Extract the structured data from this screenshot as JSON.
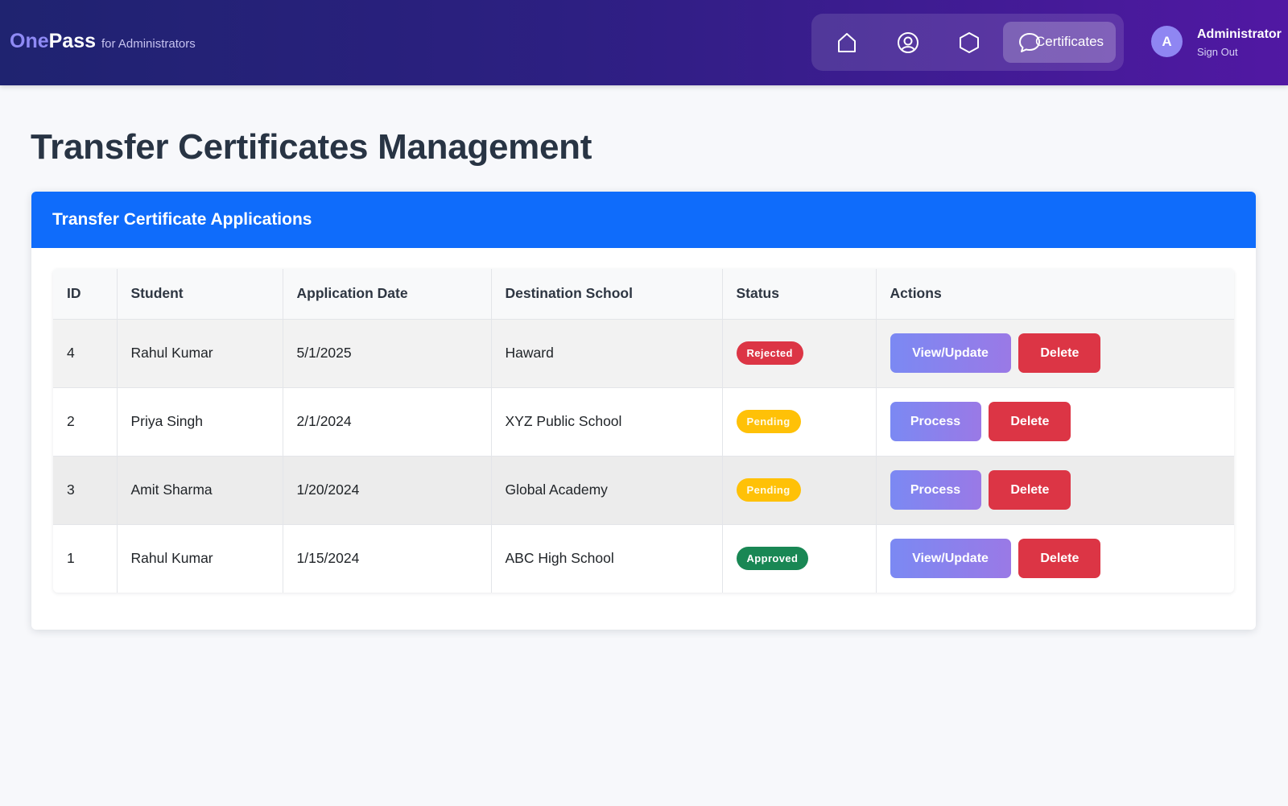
{
  "brand": {
    "name_part1": "One",
    "name_part2": "Pass",
    "subtitle": "for Administrators"
  },
  "nav": {
    "items": [
      {
        "icon": "home-icon"
      },
      {
        "icon": "user-circle-icon"
      },
      {
        "icon": "hexagon-icon"
      },
      {
        "icon": "chat-bubble-icon",
        "label": "Certificates",
        "active": true
      }
    ]
  },
  "user": {
    "avatar_letter": "A",
    "name": "Administrator",
    "signout": "Sign Out"
  },
  "page": {
    "title": "Transfer Certificates Management"
  },
  "card": {
    "title": "Transfer Certificate Applications"
  },
  "table": {
    "headers": [
      "ID",
      "Student",
      "Application Date",
      "Destination School",
      "Status",
      "Actions"
    ],
    "rows": [
      {
        "id": "4",
        "student": "Rahul Kumar",
        "date": "5/1/2025",
        "destination": "Haward",
        "status": "Rejected",
        "primary_action": "View/Update",
        "delete_action": "Delete"
      },
      {
        "id": "2",
        "student": "Priya Singh",
        "date": "2/1/2024",
        "destination": "XYZ Public School",
        "status": "Pending",
        "primary_action": "Process",
        "delete_action": "Delete"
      },
      {
        "id": "3",
        "student": "Amit Sharma",
        "date": "1/20/2024",
        "destination": "Global Academy",
        "status": "Pending",
        "primary_action": "Process",
        "delete_action": "Delete"
      },
      {
        "id": "1",
        "student": "Rahul Kumar",
        "date": "1/15/2024",
        "destination": "ABC High School",
        "status": "Approved",
        "primary_action": "View/Update",
        "delete_action": "Delete"
      }
    ]
  },
  "colors": {
    "topbar_start": "#1f2370",
    "topbar_end": "#5118a3",
    "card_header": "#0f6cfb",
    "rejected": "#dc3545",
    "pending": "#ffc107",
    "approved": "#198754",
    "delete": "#dc3545"
  }
}
